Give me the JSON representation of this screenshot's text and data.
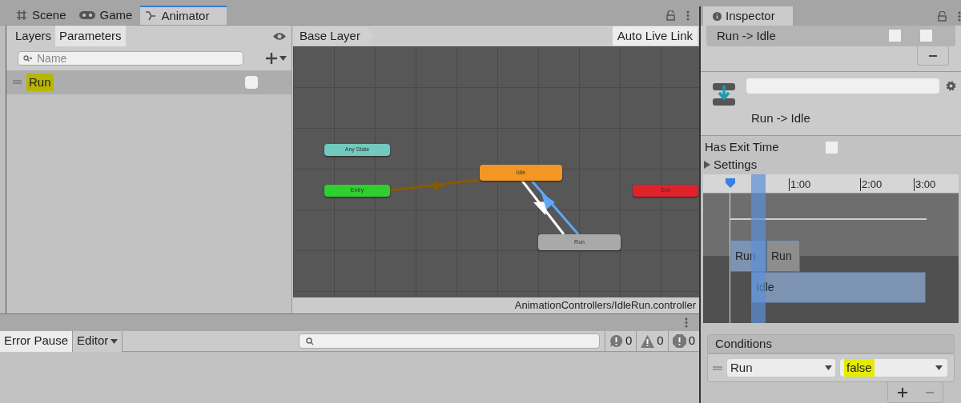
{
  "top_tabs": [
    {
      "label": "Scene",
      "kind": "scene",
      "selected": false
    },
    {
      "label": "Game",
      "kind": "game",
      "selected": false
    },
    {
      "label": "Animator",
      "kind": "animator",
      "selected": true
    }
  ],
  "animator": {
    "subtabs": [
      {
        "label": "Layers",
        "selected": false
      },
      {
        "label": "Parameters",
        "selected": true
      }
    ],
    "search": {
      "placeholder": "Name"
    },
    "parameters": [
      {
        "name": "Run",
        "highlighted": true,
        "checked": false
      }
    ],
    "breadcrumb": "Base Layer",
    "live_link": "Auto Live Link",
    "nodes": [
      {
        "label": "Any State",
        "color": "#72c9bd"
      },
      {
        "label": "Entry",
        "color": "#2fcf2f"
      },
      {
        "label": "Idle",
        "color": "#f29624"
      },
      {
        "label": "Run",
        "color": "#a9a9a9"
      },
      {
        "label": "Exit",
        "color": "#e0222a"
      }
    ],
    "footer_path": "AnimationControllers/IdleRun.controller"
  },
  "inspector": {
    "tab": "Inspector",
    "transition_row": {
      "label": "Run -> Idle",
      "checks": [
        false,
        false
      ]
    },
    "title": "Run -> Idle",
    "has_exit_time": {
      "label": "Has Exit Time",
      "checked": false
    },
    "settings": {
      "label": "Settings",
      "expanded": false
    },
    "timeline": {
      "ticks": [
        "1:00",
        "2:00",
        "3:00"
      ],
      "clips": [
        {
          "label": "Run"
        },
        {
          "label": "Run"
        },
        {
          "label": "Idle"
        }
      ]
    },
    "conditions": {
      "title": "Conditions",
      "rows": [
        {
          "parameter": "Run",
          "value": "false",
          "highlighted": true
        }
      ]
    }
  },
  "console": {
    "buttons": [
      {
        "label": "Error Pause",
        "kind": "toggle",
        "selected": true
      },
      {
        "label": "Editor",
        "kind": "dropdown",
        "selected": false
      }
    ],
    "counts": [
      {
        "kind": "info",
        "count": "0"
      },
      {
        "kind": "warning",
        "count": "0"
      },
      {
        "kind": "error",
        "count": "0"
      }
    ]
  }
}
